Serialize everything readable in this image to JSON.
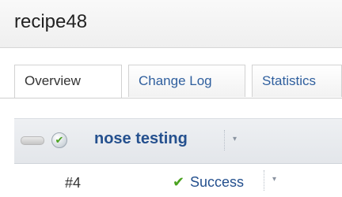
{
  "project": {
    "title": "recipe48"
  },
  "tabs": [
    {
      "label": "Overview",
      "active": true
    },
    {
      "label": "Change Log",
      "active": false
    },
    {
      "label": "Statistics",
      "active": false
    }
  ],
  "build": {
    "name": "nose testing",
    "status_icon": "check-circle-icon",
    "dropdown_glyph": "▾",
    "rows": [
      {
        "number": "#4",
        "status_icon": "check-icon",
        "status_glyph": "✔",
        "status": "Success"
      }
    ]
  },
  "colors": {
    "link": "#24508e",
    "success": "#4aa21f"
  }
}
